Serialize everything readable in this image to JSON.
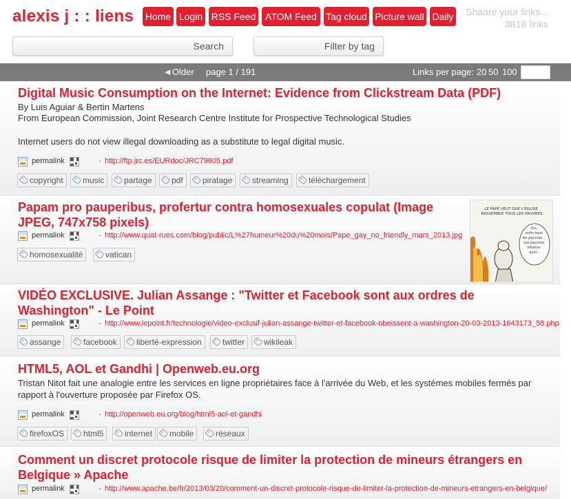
{
  "header": {
    "title": "alexis j : : liens",
    "nav": [
      "Home",
      "Login",
      "RSS Feed",
      "ATOM Feed",
      "Tag cloud",
      "Picture wall",
      "Daily"
    ],
    "tagline": "Shaare your links...",
    "link_count": "3818 links"
  },
  "search": {
    "text_button": "Search",
    "tag_button": "Filter by tag"
  },
  "paging": {
    "older": "◄Older",
    "page": "page 1 / 191",
    "per_page_label": "Links per page:",
    "per_page_options": [
      "20",
      "50",
      "100"
    ]
  },
  "links": [
    {
      "title": "Digital Music Consumption on the Internet: Evidence from Clickstream Data (PDF)",
      "desc_lines": [
        "By Luis Aguiar & Bertin Martens",
        "From European Commission, Joint Research Centre Institute for Prospective Technological Studies",
        "",
        "Internet users do not view illegal downloading as a substitute to legal digital music."
      ],
      "permalink": "permalink",
      "url": "http://ftp.jrc.es/EURdoc/JRC79605.pdf",
      "tags": [
        "copyright",
        "music",
        "partage",
        "pdf",
        "piratage",
        "streaming",
        "téléchargement"
      ]
    },
    {
      "title": "Papam pro pauperibus, profertur contra homosexuales copulat (Image JPEG, 747x758 pixels)",
      "desc_lines": [],
      "permalink": "permalink",
      "url": "http://www.quat-rues.com/blog/public/L%27humeur%20du%20mois/Pape_gay_no_friendly_mars_2013.jpg",
      "tags": [
        "homosexualité",
        "vatican"
      ],
      "thumbnail": {
        "heading": "LE PAPE VEUT QUE L'EGLISE RASSEMBLE TOUS LES PAUVRES",
        "bubble": "Oui, enfin tous les pauvres... Les pauvres hétéros quoi..."
      }
    },
    {
      "title": "VIDÉO EXCLUSIVE. Julian Assange : \"Twitter et Facebook sont aux ordres de Washington\" - Le Point",
      "desc_lines": [],
      "permalink": "permalink",
      "url": "http://www.lepoint.fr/technologie/video-exclusif-julian-assange-twitter-et-facebook-obeissent-a-washington-20-03-2013-1643173_58.php",
      "tags": [
        "assange",
        "facebook",
        "liberté-expression",
        "twitter",
        "wikileak"
      ]
    },
    {
      "title": "HTML5, AOL et Gandhi | Openweb.eu.org",
      "desc_lines": [
        "Tristan Nitot fait une analogie entre les services en ligne propriétaires face à l'arrivée du Web, et les systèmes mobiles fermés par",
        "rapport à l'ouverture proposée par Firefox OS."
      ],
      "permalink": "permalink",
      "url": "http://openweb.eu.org/blog/html5-aol-et-gandhi",
      "tags": [
        "firefoxOS",
        "html5",
        "internet",
        "mobile",
        "réseaux"
      ]
    },
    {
      "title": "Comment un discret protocole risque de limiter la protection de mineurs étrangers en Belgique » Apache",
      "desc_lines": [],
      "permalink": "permalink",
      "url": "http://www.apache.be/fr/2013/03/20/comment-un-discret-protocole-risque-de-limiter-la-protection-de-mineurs-etrangers-en-belgique/",
      "tags": []
    }
  ],
  "colors": {
    "accent": "#e0202f",
    "bar": "#7b7b7b"
  },
  "separator": "-"
}
